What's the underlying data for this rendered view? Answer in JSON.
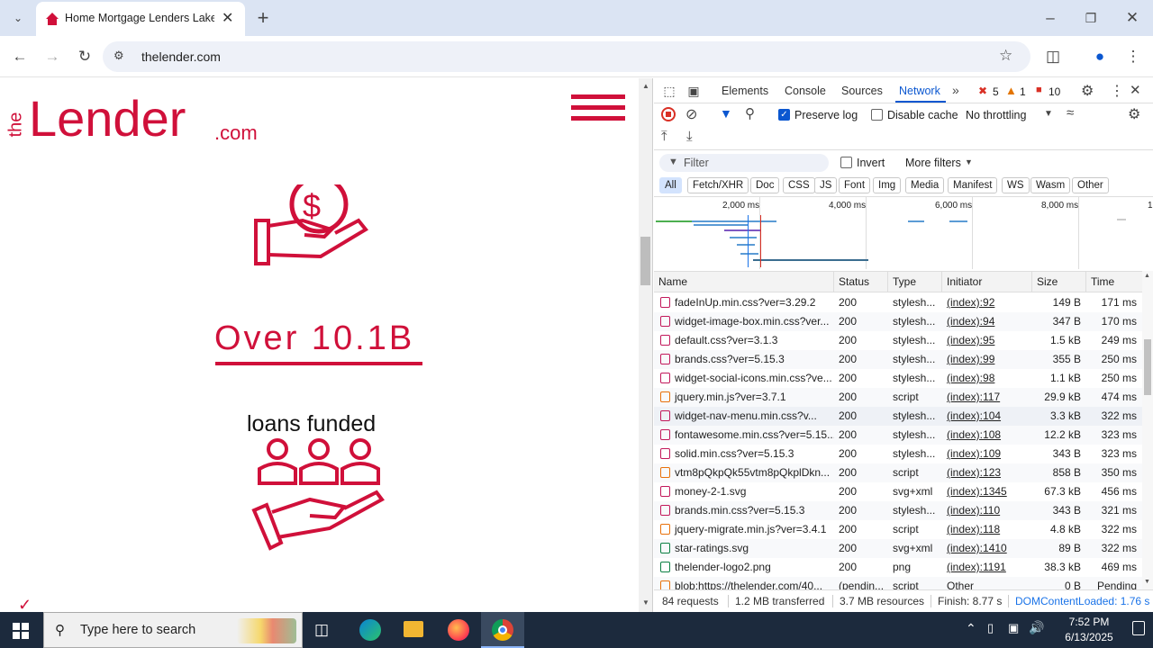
{
  "browser": {
    "tab_title": "Home Mortgage Lenders Lake",
    "url": "thelender.com",
    "new_tab_label": "+"
  },
  "page": {
    "logo_prefix": "the",
    "logo_main": "Lender",
    "logo_suffix": ".com",
    "stat_value": "Over 10.1B",
    "stat_label": "loans funded"
  },
  "devtools": {
    "tabs": [
      "Elements",
      "Console",
      "Sources",
      "Network"
    ],
    "active_tab": "Network",
    "errors": "5",
    "warnings": "1",
    "issues": "10",
    "preserve_log": "Preserve log",
    "disable_cache": "Disable cache",
    "throttling": "No throttling",
    "filter_placeholder": "Filter",
    "invert": "Invert",
    "more_filters": "More filters",
    "filter_chips": [
      "All",
      "Fetch/XHR",
      "Doc",
      "CSS",
      "JS",
      "Font",
      "Img",
      "Media",
      "Manifest",
      "WS",
      "Wasm",
      "Other"
    ],
    "timeline_ticks": [
      "2,000 ms",
      "4,000 ms",
      "6,000 ms",
      "8,000 ms",
      "1"
    ],
    "columns": [
      "Name",
      "Status",
      "Type",
      "Initiator",
      "Size",
      "Time"
    ],
    "rows": [
      {
        "name": "fadeInUp.min.css?ver=3.29.2",
        "status": "200",
        "type": "stylesh...",
        "initiator": "(index):92",
        "size": "149 B",
        "time": "171 ms",
        "kind": "css"
      },
      {
        "name": "widget-image-box.min.css?ver...",
        "status": "200",
        "type": "stylesh...",
        "initiator": "(index):94",
        "size": "347 B",
        "time": "170 ms",
        "kind": "css"
      },
      {
        "name": "default.css?ver=3.1.3",
        "status": "200",
        "type": "stylesh...",
        "initiator": "(index):95",
        "size": "1.5 kB",
        "time": "249 ms",
        "kind": "css"
      },
      {
        "name": "brands.css?ver=5.15.3",
        "status": "200",
        "type": "stylesh...",
        "initiator": "(index):99",
        "size": "355 B",
        "time": "250 ms",
        "kind": "css"
      },
      {
        "name": "widget-social-icons.min.css?ve...",
        "status": "200",
        "type": "stylesh...",
        "initiator": "(index):98",
        "size": "1.1 kB",
        "time": "250 ms",
        "kind": "css"
      },
      {
        "name": "jquery.min.js?ver=3.7.1",
        "status": "200",
        "type": "script",
        "initiator": "(index):117",
        "size": "29.9 kB",
        "time": "474 ms",
        "kind": "script"
      },
      {
        "name": "widget-nav-menu.min.css?v...",
        "status": "200",
        "type": "stylesh...",
        "initiator": "(index):104",
        "size": "3.3 kB",
        "time": "322 ms",
        "kind": "css"
      },
      {
        "name": "fontawesome.min.css?ver=5.15...",
        "status": "200",
        "type": "stylesh...",
        "initiator": "(index):108",
        "size": "12.2 kB",
        "time": "323 ms",
        "kind": "css"
      },
      {
        "name": "solid.min.css?ver=5.15.3",
        "status": "200",
        "type": "stylesh...",
        "initiator": "(index):109",
        "size": "343 B",
        "time": "323 ms",
        "kind": "css"
      },
      {
        "name": "vtm8pQkpQk55vtm8pQkplDkn...",
        "status": "200",
        "type": "script",
        "initiator": "(index):123",
        "size": "858 B",
        "time": "350 ms",
        "kind": "script"
      },
      {
        "name": "money-2-1.svg",
        "status": "200",
        "type": "svg+xml",
        "initiator": "(index):1345",
        "size": "67.3 kB",
        "time": "456 ms",
        "kind": "svg"
      },
      {
        "name": "brands.min.css?ver=5.15.3",
        "status": "200",
        "type": "stylesh...",
        "initiator": "(index):110",
        "size": "343 B",
        "time": "321 ms",
        "kind": "css"
      },
      {
        "name": "jquery-migrate.min.js?ver=3.4.1",
        "status": "200",
        "type": "script",
        "initiator": "(index):118",
        "size": "4.8 kB",
        "time": "322 ms",
        "kind": "script"
      },
      {
        "name": "star-ratings.svg",
        "status": "200",
        "type": "svg+xml",
        "initiator": "(index):1410",
        "size": "89 B",
        "time": "322 ms",
        "kind": "img"
      },
      {
        "name": "thelender-logo2.png",
        "status": "200",
        "type": "png",
        "initiator": "(index):1191",
        "size": "38.3 kB",
        "time": "469 ms",
        "kind": "png"
      },
      {
        "name": "blob:https://thelender.com/40...",
        "status": "(pendin...",
        "type": "script",
        "initiator": "Other",
        "size": "0 B",
        "time": "Pending",
        "kind": "script"
      }
    ],
    "status": {
      "requests": "84 requests",
      "transferred": "1.2 MB transferred",
      "resources": "3.7 MB resources",
      "finish": "Finish: 8.77 s",
      "dcl": "DOMContentLoaded: 1.76 s"
    }
  },
  "taskbar": {
    "search_placeholder": "Type here to search",
    "time": "7:52 PM",
    "date": "6/13/2025"
  },
  "colors": {
    "brand_red": "#d0103a",
    "accent_blue": "#0b57d0",
    "taskbar": "#1c2a3d"
  }
}
